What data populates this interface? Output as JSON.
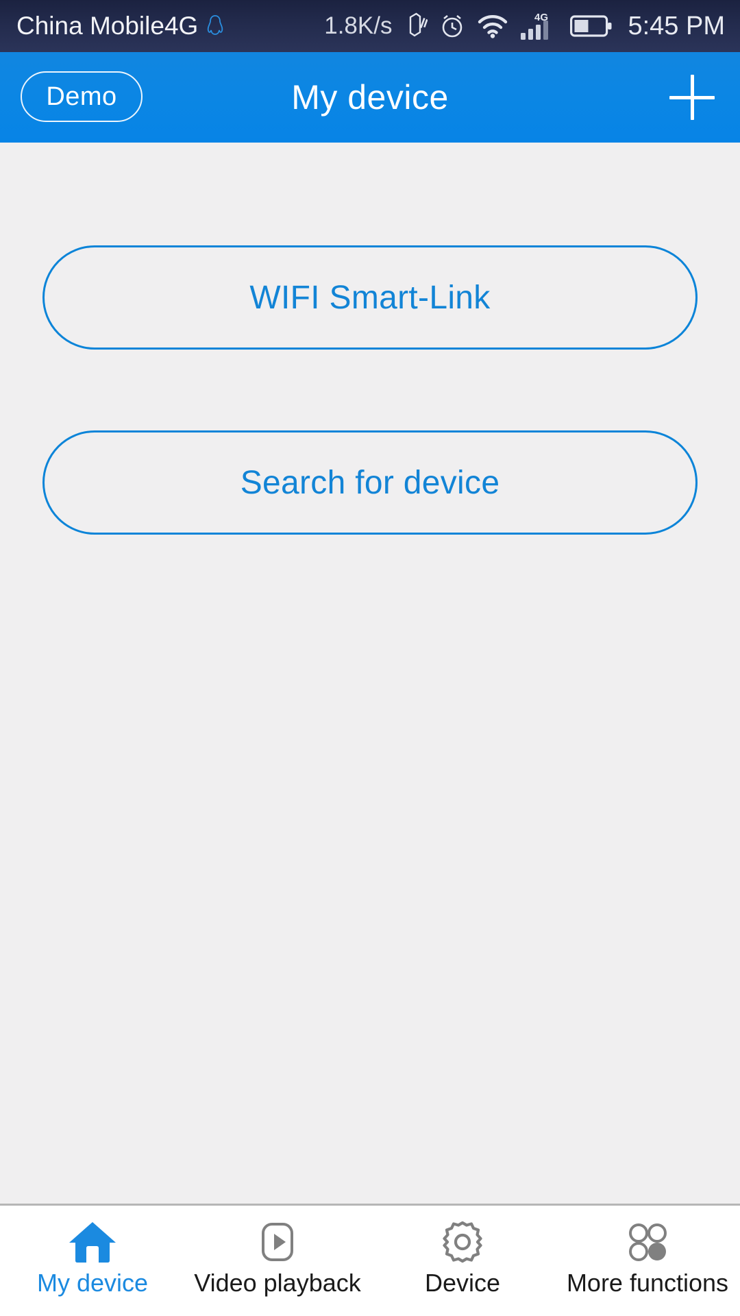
{
  "status_bar": {
    "carrier": "China Mobile4G",
    "qq_icon": "qq-penguin-icon",
    "net_speed": "1.8K/s",
    "icons": [
      "vibrate-icon",
      "alarm-clock-icon",
      "wifi-icon",
      "signal-bars-icon",
      "battery-icon"
    ],
    "network_type": "4G",
    "time": "5:45 PM",
    "background_color": "#232b4d",
    "text_color": "#ffffff"
  },
  "header": {
    "demo_label": "Demo",
    "title": "My device",
    "add_icon": "plus-icon",
    "background_color": "#0b86e4",
    "text_color": "#ffffff"
  },
  "main": {
    "background_color": "#f0eff0",
    "accent_color": "#0c84d8",
    "buttons": [
      {
        "label": "WIFI Smart-Link"
      },
      {
        "label": "Search for device"
      }
    ]
  },
  "bottom_nav": {
    "active_color": "#1b8ae0",
    "inactive_color": "#1a1a1a",
    "items": [
      {
        "label": "My device",
        "icon": "home-icon",
        "active": true
      },
      {
        "label": "Video playback",
        "icon": "play-square-icon",
        "active": false
      },
      {
        "label": "Device",
        "icon": "gear-icon",
        "active": false
      },
      {
        "label": "More functions",
        "icon": "four-circles-icon",
        "active": false
      }
    ]
  }
}
